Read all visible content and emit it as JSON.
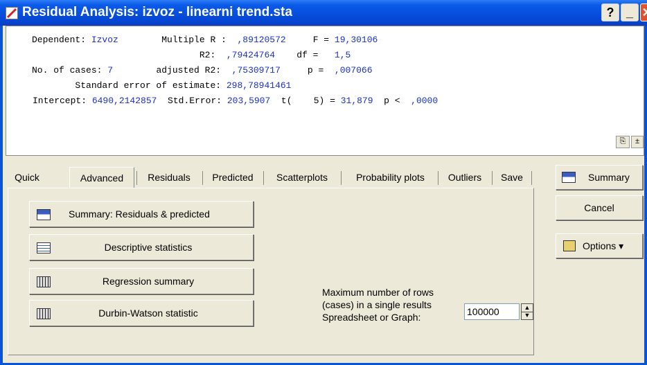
{
  "window": {
    "title": "Residual Analysis: izvoz - linearni trend.sta"
  },
  "titlebar_buttons": {
    "help": "?",
    "minimize": "_",
    "close": "✕"
  },
  "output": {
    "line1_a": "Dependent: ",
    "dependent": "Izvoz",
    "line1_b": "        Multiple R :  ",
    "multiple_r": ",89120572",
    "line1_c": "     F = ",
    "f": "19,30106",
    "line2_a": "                               R2:  ",
    "r2": ",79424764",
    "line2_b": "    df =   ",
    "df": "1,5",
    "line3_a": "No. of cases: ",
    "cases": "7",
    "line3_b": "        adjusted R2:  ",
    "adj_r2": ",75309717",
    "line3_c": "     p =  ",
    "p": ",007066",
    "line4_a": "        Standard error of estimate: ",
    "std_err_est": "298,78941461",
    "line5_a": "Intercept: ",
    "intercept": "6490,2142857",
    "line5_b": "  Std.Error: ",
    "std_error": "203,5907",
    "line5_c": "  t(    5) = ",
    "t": "31,879",
    "line5_d": "  p <  ",
    "p2": ",0000"
  },
  "tabs": [
    "Quick",
    "Advanced",
    "Residuals",
    "Predicted",
    "Scatterplots",
    "Probability plots",
    "Outliers",
    "Save"
  ],
  "active_tab": "Advanced",
  "buttons": {
    "summary_resid": "Summary:  Residuals & predicted",
    "descriptive": "Descriptive statistics",
    "regression": "Regression summary",
    "durbin": "Durbin-Watson statistic"
  },
  "max_rows": {
    "label_1": "Maximum number of rows",
    "label_2": "(cases) in a single results",
    "label_3": "Spreadsheet or Graph:",
    "value": "100000"
  },
  "side": {
    "summary": "Summary",
    "cancel": "Cancel",
    "options": "Options ▾"
  }
}
